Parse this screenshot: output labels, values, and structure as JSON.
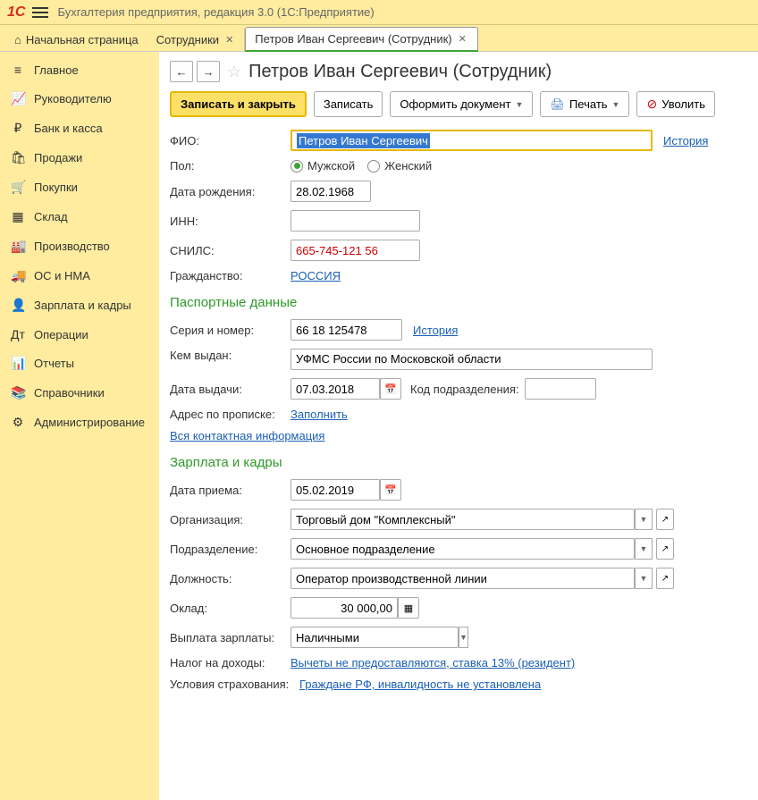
{
  "titlebar": {
    "logo": "1C",
    "title": "Бухгалтерия предприятия, редакция 3.0  (1С:Предприятие)"
  },
  "tabs": {
    "home": "Начальная страница",
    "t1": "Сотрудники",
    "t2": "Петров Иван Сергеевич (Сотрудник)"
  },
  "sidebar": [
    {
      "icon": "≡",
      "label": "Главное"
    },
    {
      "icon": "📈",
      "label": "Руководителю"
    },
    {
      "icon": "₽",
      "label": "Банк и касса"
    },
    {
      "icon": "🛍",
      "label": "Продажи"
    },
    {
      "icon": "🛒",
      "label": "Покупки"
    },
    {
      "icon": "▦",
      "label": "Склад"
    },
    {
      "icon": "🏭",
      "label": "Производство"
    },
    {
      "icon": "🚚",
      "label": "ОС и НМА"
    },
    {
      "icon": "👤",
      "label": "Зарплата и кадры"
    },
    {
      "icon": "Дт",
      "label": "Операции"
    },
    {
      "icon": "📊",
      "label": "Отчеты"
    },
    {
      "icon": "📚",
      "label": "Справочники"
    },
    {
      "icon": "⚙",
      "label": "Администрирование"
    }
  ],
  "header": {
    "title": "Петров Иван Сергеевич (Сотрудник)"
  },
  "toolbar": {
    "save_close": "Записать и закрыть",
    "save": "Записать",
    "create_doc": "Оформить документ",
    "print": "Печать",
    "fire": "Уволить"
  },
  "form": {
    "fio_lbl": "ФИО:",
    "fio": "Петров Иван Сергеевич",
    "history": "История",
    "sex_lbl": "Пол:",
    "male": "Мужской",
    "female": "Женский",
    "dob_lbl": "Дата рождения:",
    "dob": "28.02.1968",
    "inn_lbl": "ИНН:",
    "inn": "",
    "snils_lbl": "СНИЛС:",
    "snils": "665-745-121 56",
    "citizen_lbl": "Гражданство:",
    "citizen": "РОССИЯ"
  },
  "passport": {
    "title": "Паспортные данные",
    "serial_lbl": "Серия и номер:",
    "serial": "66 18 125478",
    "history": "История",
    "issued_lbl": "Кем выдан:",
    "issued": "УФМС России по Московской области",
    "date_lbl": "Дата выдачи:",
    "date": "07.03.2018",
    "code_lbl": "Код подразделения:",
    "addr_lbl": "Адрес по прописке:",
    "addr_fill": "Заполнить",
    "contact": "Вся контактная информация"
  },
  "hr": {
    "title": "Зарплата и кадры",
    "hire_lbl": "Дата приема:",
    "hire": "05.02.2019",
    "org_lbl": "Организация:",
    "org": "Торговый дом \"Комплексный\"",
    "dept_lbl": "Подразделение:",
    "dept": "Основное подразделение",
    "pos_lbl": "Должность:",
    "pos": "Оператор производственной линии",
    "salary_lbl": "Оклад:",
    "salary": "30 000,00",
    "pay_lbl": "Выплата зарплаты:",
    "pay": "Наличными",
    "tax_lbl": "Налог на доходы:",
    "tax": "Вычеты не предоставляются, ставка 13% (резидент)",
    "ins_lbl": "Условия страхования:",
    "ins": "Граждане РФ, инвалидность не установлена"
  }
}
